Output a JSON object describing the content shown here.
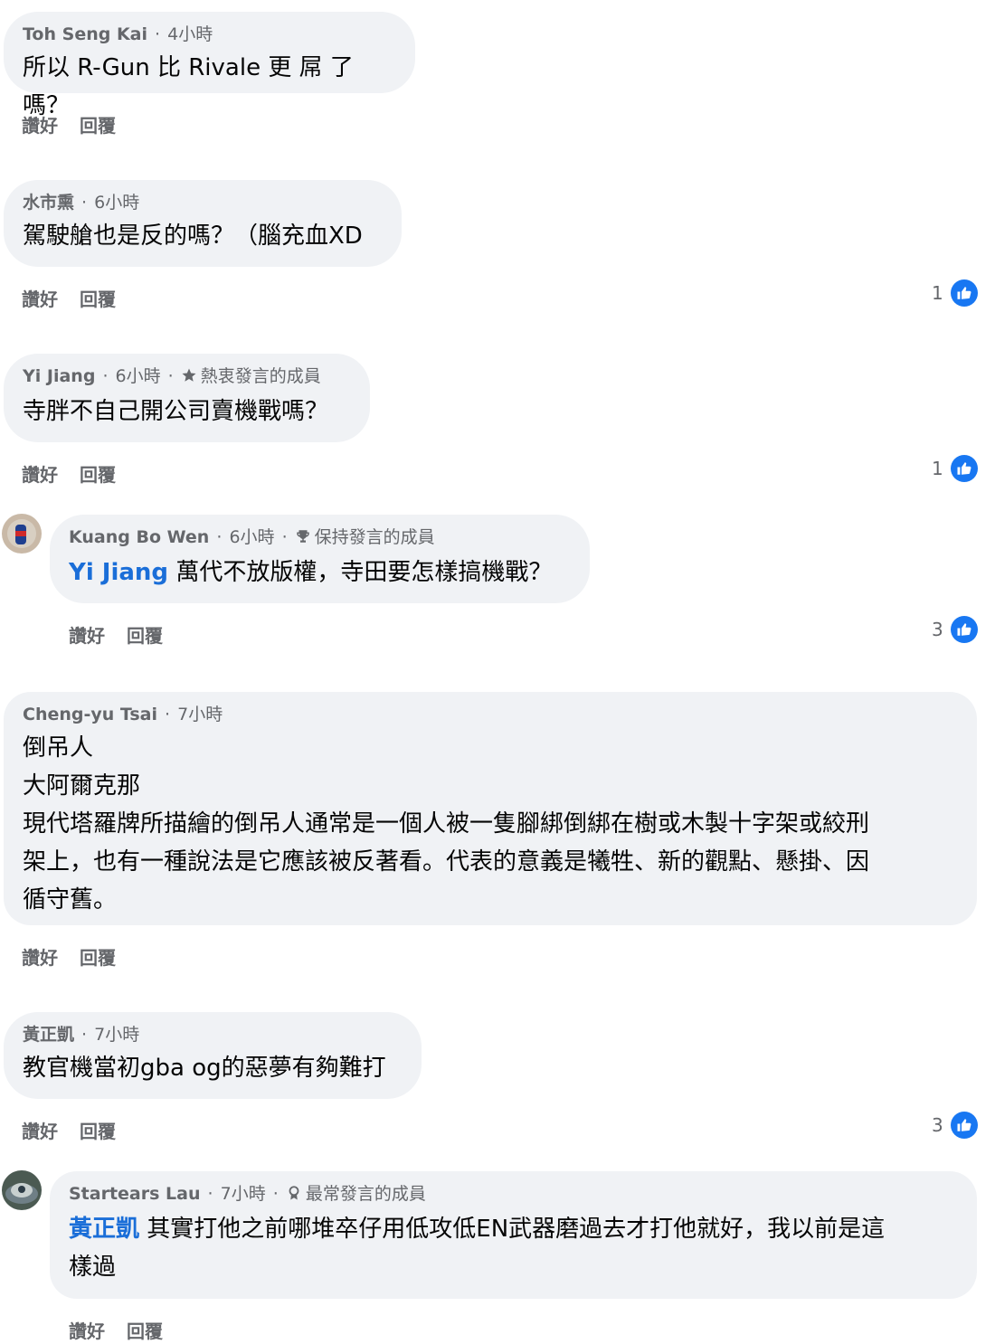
{
  "actions": {
    "like": "讚好",
    "reply": "回覆"
  },
  "comments": [
    {
      "author": "Toh Seng Kai",
      "time": "4小時",
      "text": "所以 R-Gun 比 Rivale 更 屌 了嗎？"
    },
    {
      "author": "水市熏",
      "time": "6小時",
      "text": "駕駛艙也是反的嗎？（腦充血XD",
      "likes": "1"
    },
    {
      "author": "Yi Jiang",
      "time": "6小時",
      "badge": "熱衷發言的成員",
      "badge_icon": "star-icon",
      "text": "寺胖不自己開公司賣機戰嗎？",
      "likes": "1"
    },
    {
      "author": "Kuang Bo Wen",
      "time": "6小時",
      "badge": "保持發言的成員",
      "badge_icon": "trophy-icon",
      "mention": "Yi Jiang",
      "text": "萬代不放版權，寺田要怎樣搞機戰？",
      "likes": "3"
    },
    {
      "author": "Cheng-yu Tsai",
      "time": "7小時",
      "text_lines": [
        "倒吊人",
        "大阿爾克那",
        "現代塔羅牌所描繪的倒吊人通常是一個人被一隻腳綁倒綁在樹或木製十字架或絞刑",
        "架上，也有一種說法是它應該被反著看。代表的意義是犧牲、新的觀點、懸掛、因",
        "循守舊。"
      ]
    },
    {
      "author": "黃正凱",
      "time": "7小時",
      "text": "教官機當初gba og的惡夢有夠難打",
      "likes": "3"
    },
    {
      "author": "Startears Lau",
      "time": "7小時",
      "badge": "最常發言的成員",
      "badge_icon": "award-icon",
      "mention": "黃正凱",
      "text_lines": [
        "其實打他之前哪堆卒仔用低攻低EN武器磨過去才打他就好，我以前是這",
        "樣過"
      ]
    }
  ],
  "colors": {
    "bubble": "#f0f2f5",
    "meta": "#65676b",
    "mention": "#1a6ed8",
    "like": "#1877f2"
  }
}
